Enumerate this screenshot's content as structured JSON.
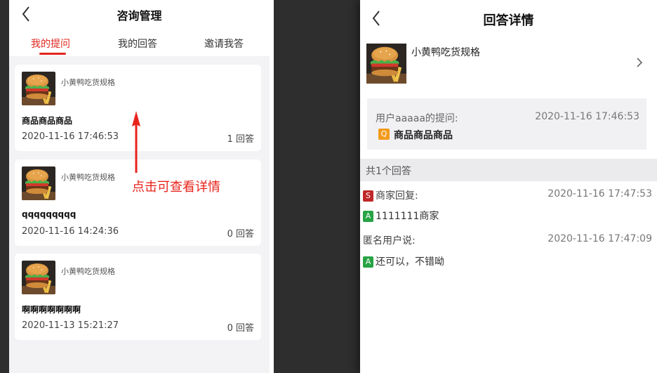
{
  "left": {
    "title": "咨询管理",
    "tabs": [
      "我的提问",
      "我的回答",
      "邀请我答"
    ],
    "cards": [
      {
        "shop": "小黄鸭吃货规格",
        "question": "商品商品商品",
        "date": "2020-11-16 17:46:53",
        "count": "1 回答"
      },
      {
        "shop": "小黄鸭吃货规格",
        "question": "qqqqqqqqq",
        "date": "2020-11-16 14:24:36",
        "count": "0 回答"
      },
      {
        "shop": "小黄鸭吃货规格",
        "question": "啊啊啊啊啊啊啊",
        "date": "2020-11-13 15:21:27",
        "count": "0 回答"
      }
    ],
    "annotation": "点击可查看详情"
  },
  "right": {
    "title": "回答详情",
    "shop": "小黄鸭吃货规格",
    "asker": "用户aaaaa的提问:",
    "question_date": "2020-11-16 17:46:53",
    "q_badge": "Q",
    "question": "商品商品商品",
    "total": "共1个回答",
    "answers": [
      {
        "badge": "S",
        "who": "商家回复:",
        "date": "2020-11-16 17:47:53",
        "a_badge": "A",
        "text": "1111111商家"
      },
      {
        "badge": "",
        "who": "匿名用户说:",
        "date": "2020-11-16 17:47:09",
        "a_badge": "A",
        "text": "还可以，不错呦"
      }
    ]
  },
  "icons": {
    "back": "chevron-left-icon",
    "detail": "chevron-right-icon",
    "product": "burger-thumbnail",
    "annotation_arrow": "red-arrow-up"
  },
  "colors": {
    "accent": "#e0271e",
    "question_badge": "#f39a1c",
    "seller_badge": "#c0262a",
    "answer_badge": "#27a345"
  }
}
